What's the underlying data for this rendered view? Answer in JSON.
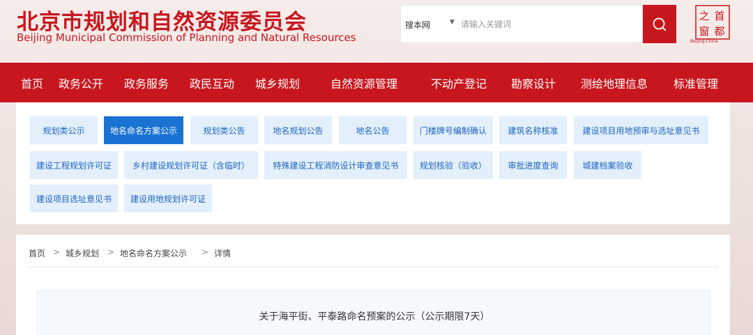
{
  "header": {
    "title_cn": "北京市规划和自然资源委员会",
    "title_en": "Beijing Municipal Commission of Planning and Natural Resources",
    "search_scope": "搜本网",
    "search_placeholder": "请输入关键词",
    "logo_chars": [
      "之",
      "首",
      "窗",
      "都"
    ],
    "logo_sub": "Beijing-China"
  },
  "nav": {
    "items": [
      "首页",
      "政务公开",
      "政务服务",
      "政民互动",
      "城乡规划",
      "自然资源管理",
      "不动产登记",
      "勘察设计",
      "测绘地理信息",
      "标准管理"
    ]
  },
  "subnav": {
    "items": [
      {
        "label": "规划类公示",
        "active": false
      },
      {
        "label": "地名命名方案公示",
        "active": true
      },
      {
        "label": "规划类公告",
        "active": false
      },
      {
        "label": "地名规划公告",
        "active": false
      },
      {
        "label": "地名公告",
        "active": false
      },
      {
        "label": "门楼牌号编制确认",
        "active": false
      },
      {
        "label": "建筑名称核准",
        "active": false
      },
      {
        "label": "建设项目用地预审与选址意见书",
        "active": false
      },
      {
        "label": "建设工程规划许可证",
        "active": false
      },
      {
        "label": "乡村建设规划许可证（含临时）",
        "active": false
      },
      {
        "label": "特殊建设工程消防设计审查意见书",
        "active": false
      },
      {
        "label": "规划核验（验收）",
        "active": false
      },
      {
        "label": "审批进度查询",
        "active": false
      },
      {
        "label": "城建档案验收",
        "active": false
      },
      {
        "label": "建设项目选址意见书",
        "active": false
      },
      {
        "label": "建设用地规划许可证",
        "active": false
      }
    ]
  },
  "breadcrumb": {
    "items": [
      "首页",
      "城乡规划",
      "地名命名方案公示",
      "详情"
    ],
    "separator": ">"
  },
  "article": {
    "title": "关于海平街、平泰路命名预案的公示（公示期限7天）"
  },
  "colors": {
    "brand_red": "#c8161e",
    "chip_bg": "#e3f0fb",
    "chip_text": "#1f63c2",
    "chip_active": "#1a72d3"
  }
}
